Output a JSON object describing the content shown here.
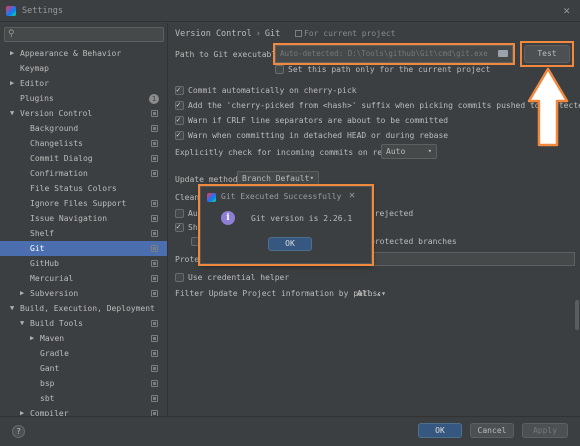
{
  "window": {
    "title": "Settings"
  },
  "sidebar": {
    "search_placeholder": "",
    "items": [
      {
        "label": "Appearance & Behavior",
        "arrow": "▶",
        "settings_icon": false
      },
      {
        "label": "Keymap",
        "arrow": "",
        "settings_icon": false
      },
      {
        "label": "Editor",
        "arrow": "▶",
        "settings_icon": false
      },
      {
        "label": "Plugins",
        "arrow": "",
        "badge": "1"
      },
      {
        "label": "Version Control",
        "arrow": "▼",
        "settings_icon": true
      },
      {
        "label": "Background",
        "arrow": "",
        "settings_icon": true
      },
      {
        "label": "Changelists",
        "arrow": "",
        "settings_icon": true
      },
      {
        "label": "Commit Dialog",
        "arrow": "",
        "settings_icon": true
      },
      {
        "label": "Confirmation",
        "arrow": "",
        "settings_icon": true
      },
      {
        "label": "File Status Colors",
        "arrow": "",
        "settings_icon": false
      },
      {
        "label": "Ignore Files Support",
        "arrow": "",
        "settings_icon": true
      },
      {
        "label": "Issue Navigation",
        "arrow": "",
        "settings_icon": true
      },
      {
        "label": "Shelf",
        "arrow": "",
        "settings_icon": true
      },
      {
        "label": "Git",
        "arrow": "",
        "settings_icon": true,
        "selected": true
      },
      {
        "label": "GitHub",
        "arrow": "",
        "settings_icon": true
      },
      {
        "label": "Mercurial",
        "arrow": "",
        "settings_icon": true
      },
      {
        "label": "Subversion",
        "arrow": "▶",
        "settings_icon": true
      },
      {
        "label": "Build, Execution, Deployment",
        "arrow": "▼",
        "settings_icon": false
      },
      {
        "label": "Build Tools",
        "arrow": "▼",
        "settings_icon": true
      },
      {
        "label": "Maven",
        "arrow": "▶",
        "settings_icon": true
      },
      {
        "label": "Gradle",
        "arrow": "",
        "settings_icon": true
      },
      {
        "label": "Gant",
        "arrow": "",
        "settings_icon": true
      },
      {
        "label": "bsp",
        "arrow": "",
        "settings_icon": true
      },
      {
        "label": "sbt",
        "arrow": "",
        "settings_icon": true
      },
      {
        "label": "Compiler",
        "arrow": "▶",
        "settings_icon": true
      }
    ]
  },
  "breadcrumb": {
    "parent": "Version Control",
    "separator": "›",
    "current": "Git",
    "scope": "For current project"
  },
  "git_path": {
    "label": "Path to Git executable:",
    "placeholder": "Auto-detected: D:\\Tools\\github\\Git\\cmd\\git.exe",
    "test_label": "Test",
    "project_only_label": "Set this path only for the current project",
    "project_only_checked": false
  },
  "options": [
    {
      "label": "Commit automatically on cherry-pick",
      "checked": true
    },
    {
      "label": "Add the 'cherry-picked from <hash>' suffix when picking commits pushed to protected b",
      "checked": true
    },
    {
      "label": "Warn if CRLF line separators are about to be committed",
      "checked": true
    },
    {
      "label": "Warn when committing in detached HEAD or during rebase",
      "checked": true
    }
  ],
  "incoming": {
    "label": "Explicitly check for incoming commits on remotes:",
    "value": "Auto"
  },
  "update_method": {
    "label": "Update method:",
    "value": "Branch Default"
  },
  "clean_label": "Clean wor",
  "autoupdate_label": "Auto-u",
  "autoupdate_suffix": "s rejected",
  "show_label": "Show P",
  "sh_label": "Sh",
  "sh_suffix": "protected branches",
  "protected": {
    "label": "Protected branches:",
    "value": "master"
  },
  "credential_helper": {
    "label": "Use credential helper",
    "checked": false
  },
  "filter": {
    "label": "Filter Update Project information by paths:",
    "value": "All"
  },
  "dialog": {
    "title": "Git Executed Successfully",
    "message": "Git version is 2.26.1",
    "ok_label": "OK",
    "info_glyph": "i"
  },
  "footer": {
    "ok_label": "OK",
    "cancel_label": "Cancel",
    "apply_label": "Apply",
    "help_glyph": "?"
  },
  "colors": {
    "highlight": "#f0883e",
    "selection": "#4b6eaf",
    "primary_button": "#365880"
  }
}
